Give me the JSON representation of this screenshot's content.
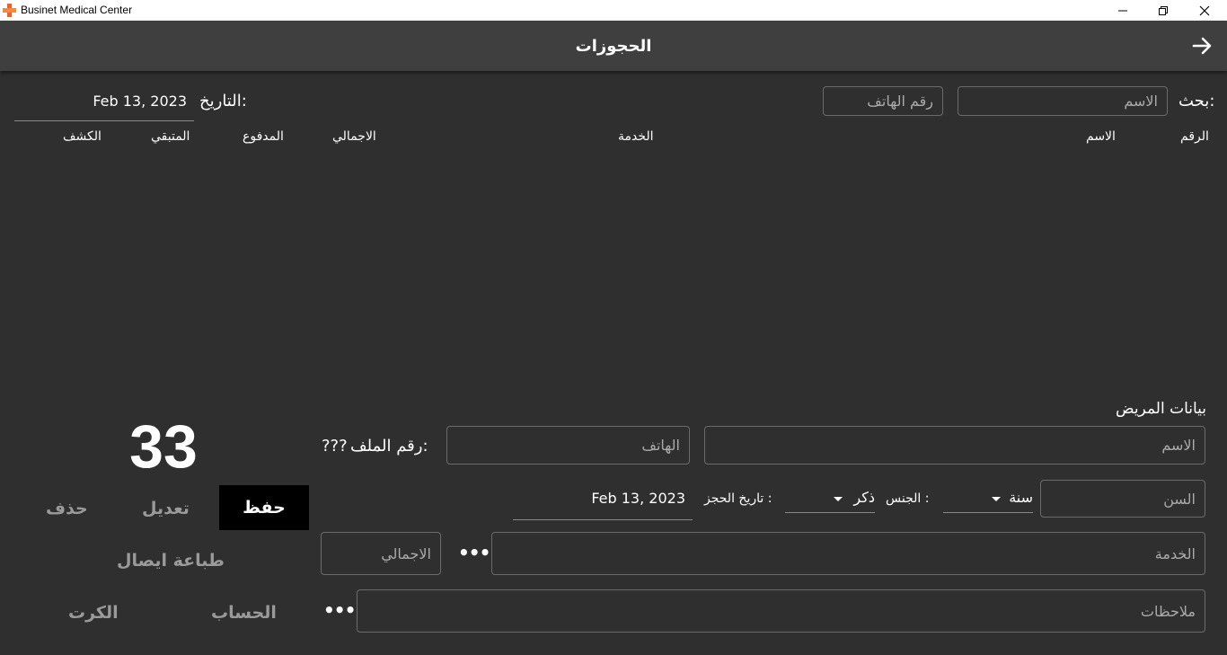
{
  "window": {
    "title": "Businet Medical Center"
  },
  "header": {
    "title": "الحجوزات"
  },
  "search": {
    "label": "بحث:",
    "name_placeholder": "الاسم",
    "phone_placeholder": "رقم الهاتف",
    "date_label": "التاريخ:",
    "date_value": "Feb 13, 2023"
  },
  "table": {
    "columns": [
      "الرقم",
      "الاسم",
      "الخدمة",
      "الاجمالي",
      "المدفوع",
      "المتبقي",
      "الكشف"
    ],
    "rows": []
  },
  "patient": {
    "section_title": "بيانات المريض",
    "name_placeholder": "الاسم",
    "phone_placeholder": "الهاتف",
    "file_no_label": "رقم الملف:",
    "file_no_value": "???",
    "age_placeholder": "السن",
    "age_unit": "سنة",
    "gender_label": "الجنس :",
    "gender_value": "ذكر",
    "booking_date_label": "تاريخ الحجز :",
    "booking_date_value": "Feb 13, 2023",
    "service_placeholder": "الخدمة",
    "total_placeholder": "الاجمالي",
    "notes_placeholder": "ملاحظات",
    "more_label": "•••"
  },
  "counter": "33",
  "actions": {
    "save": "حفظ",
    "edit": "تعديل",
    "delete": "حذف",
    "print_receipt": "طباعة ايصال",
    "account": "الحساب",
    "card": "الكرت"
  }
}
